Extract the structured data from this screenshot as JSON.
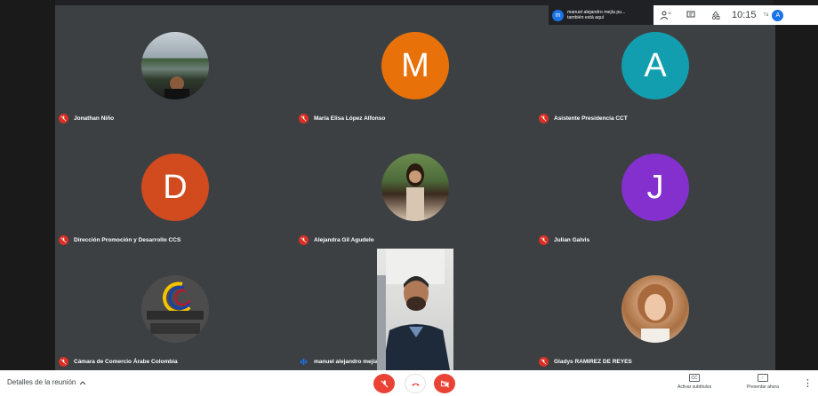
{
  "participants": [
    {
      "name": "Jonathan Niño",
      "initial": "",
      "color": "",
      "muted": true
    },
    {
      "name": "María Elisa López Alfonso",
      "initial": "M",
      "color": "#e8710a",
      "muted": true
    },
    {
      "name": "Asistente Presidencia CCT",
      "initial": "A",
      "color": "#129eaf",
      "muted": true
    },
    {
      "name": "Dirección Promoción y Desarrollo CCS",
      "initial": "D",
      "color": "#d14b1f",
      "muted": true
    },
    {
      "name": "Alejandra Gil Agudelo",
      "initial": "",
      "color": "",
      "muted": true
    },
    {
      "name": "Julian Galvis",
      "initial": "J",
      "color": "#8430ce",
      "muted": true
    },
    {
      "name": "Cámara de Comercio Árabe Colombia",
      "initial": "",
      "color": "",
      "muted": true
    },
    {
      "name": "manuel alejandro mejía puerto",
      "initial": "",
      "color": "",
      "muted": false
    },
    {
      "name": "Gladys RAMIREZ DE REYES",
      "initial": "",
      "color": "",
      "muted": true
    }
  ],
  "notification": {
    "avatar_initial": "m",
    "line1": "manuel alejandro mejía pu...",
    "line2": "también está aquí"
  },
  "topbar": {
    "participant_count": "11",
    "clock": "10:15",
    "you_label": "Tú",
    "user_initial": "A"
  },
  "bottom": {
    "meeting_details": "Detalles de la reunión",
    "captions": "Activar subtítulos",
    "present": "Presentar ahora"
  },
  "colors": {
    "mute_red": "#ea4335",
    "accent_blue": "#1a73e8"
  }
}
